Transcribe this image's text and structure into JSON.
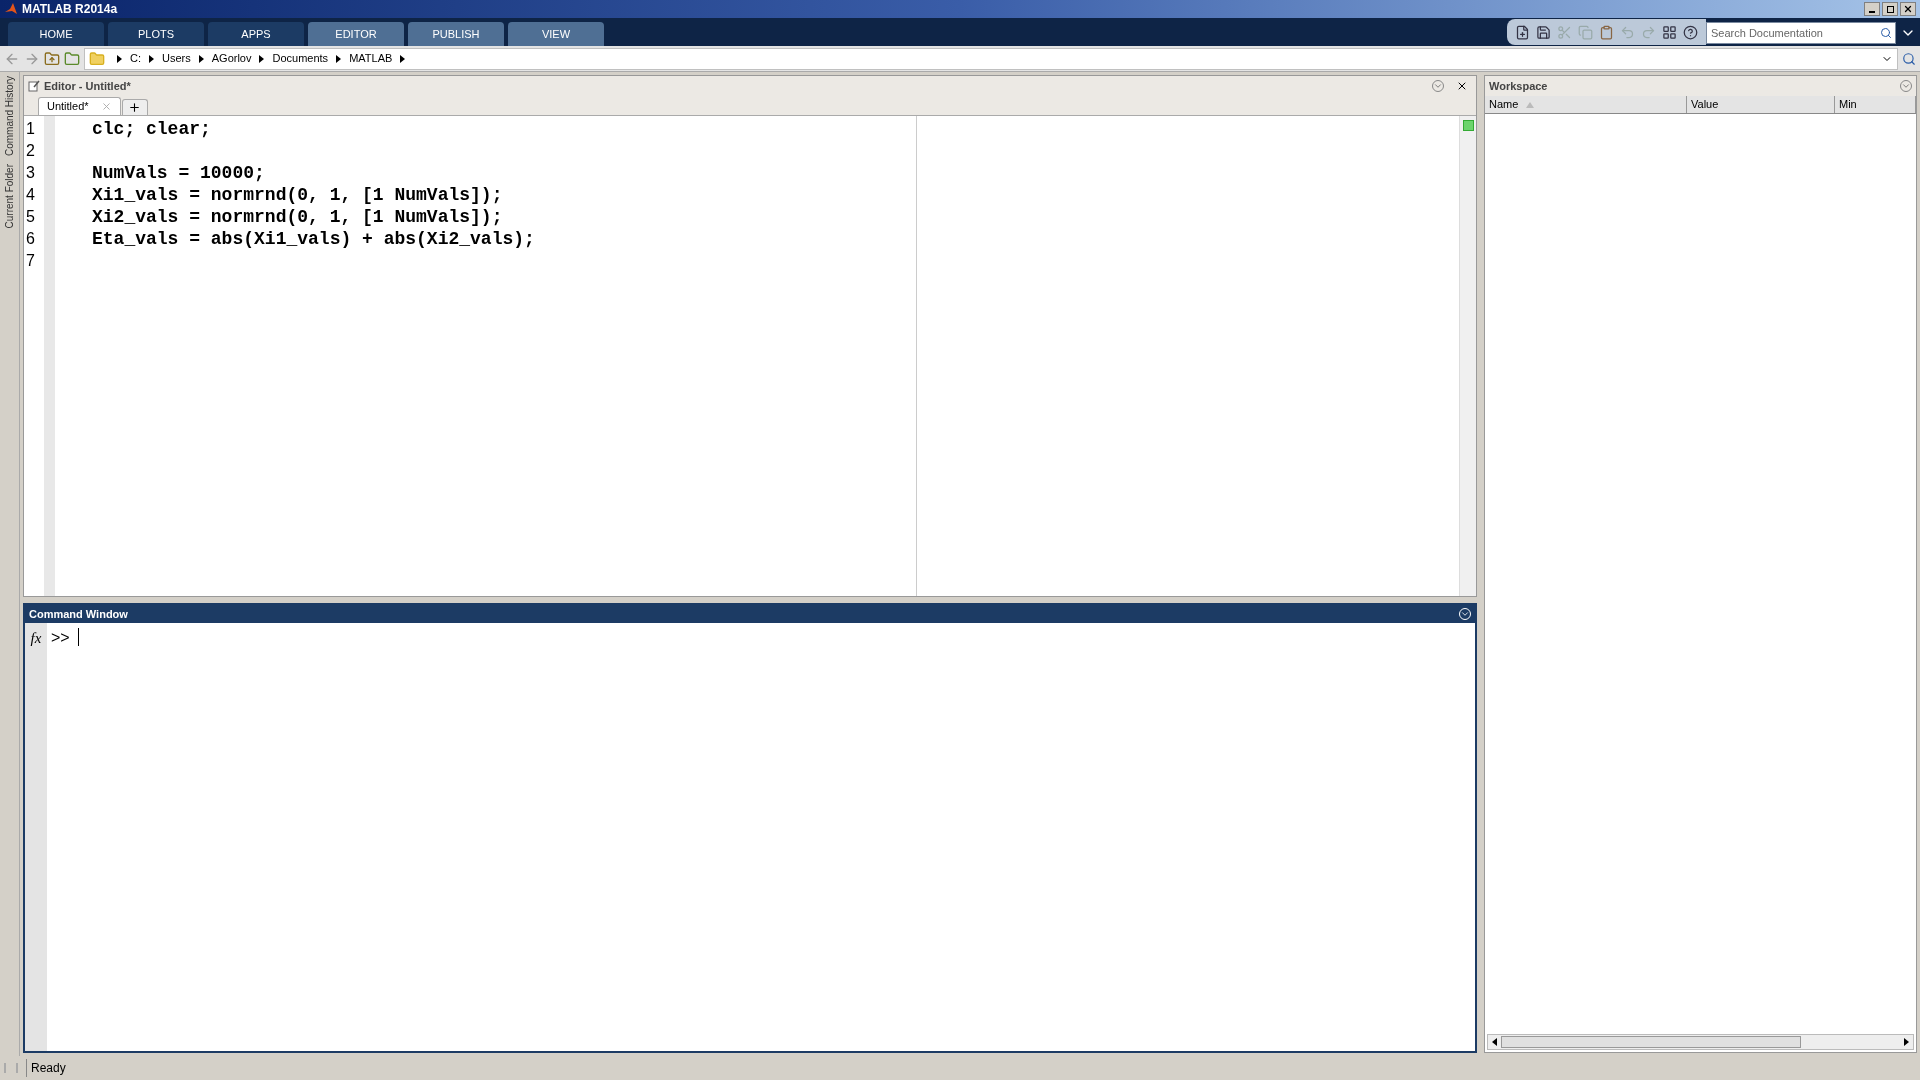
{
  "window": {
    "title": "MATLAB R2014a"
  },
  "ribbon_tabs": [
    {
      "label": "HOME",
      "kind": "main"
    },
    {
      "label": "PLOTS",
      "kind": "main"
    },
    {
      "label": "APPS",
      "kind": "main"
    },
    {
      "label": "EDITOR",
      "kind": "contextual"
    },
    {
      "label": "PUBLISH",
      "kind": "contextual"
    },
    {
      "label": "VIEW",
      "kind": "contextual"
    }
  ],
  "doc_search": {
    "placeholder": "Search Documentation"
  },
  "address_bar": {
    "path": [
      "C:",
      "Users",
      "AGorlov",
      "Documents",
      "MATLAB"
    ]
  },
  "side_tabs": [
    "Command History",
    "Current Folder"
  ],
  "editor": {
    "title": "Editor - Untitled*",
    "tabs": [
      {
        "label": "Untitled*",
        "selected": true
      }
    ],
    "lines": [
      {
        "number": "1",
        "code": "clc; clear;"
      },
      {
        "number": "2"
      },
      {
        "number": "3",
        "code": "NumVals = 10000;"
      },
      {
        "number": "4",
        "code": "Xi1_vals = normrnd(0, 1, [1 NumVals]);"
      },
      {
        "number": "5",
        "code": "Xi2_vals = normrnd(0, 1, [1 NumVals]);"
      },
      {
        "number": "6",
        "code": "Eta_vals = abs(Xi1_vals) + abs(Xi2_vals);"
      },
      {
        "number": "7"
      }
    ]
  },
  "command_window": {
    "title": "Command Window",
    "prompt": ">>",
    "function_icon": "fx"
  },
  "workspace": {
    "title": "Workspace",
    "columns": [
      "Name",
      "Value",
      "Min"
    ]
  },
  "status_bar": {
    "text": "Ready"
  }
}
